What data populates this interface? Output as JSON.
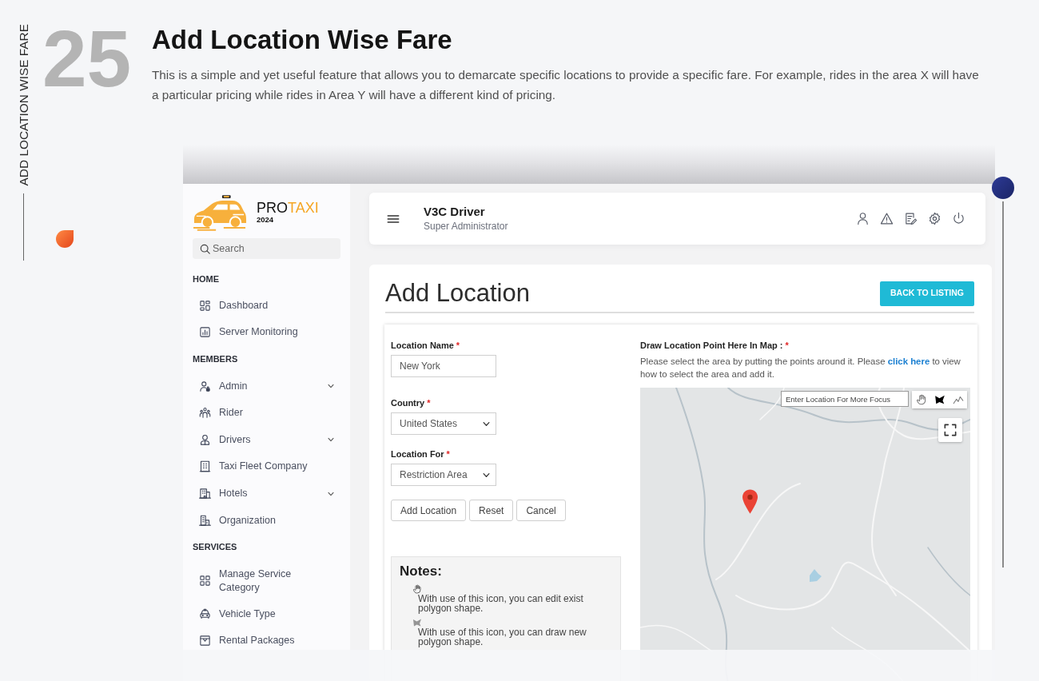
{
  "section": {
    "side_label": "ADD LOCATION WISE FARE",
    "number": "25",
    "title": "Add Location Wise Fare",
    "description": "This is a simple and yet useful feature that allows you to demarcate specific locations to provide a specific fare. For example, rides in the area X will have a particular pricing while rides in Area Y will have a different kind of pricing."
  },
  "app": {
    "brand": {
      "lead": "PRO",
      "accent": "TAXI",
      "year": "2024"
    },
    "sidebar": {
      "search": {
        "placeholder": "Search"
      },
      "groups": [
        {
          "heading": "HOME",
          "items": [
            {
              "label": "Dashboard",
              "has_submenu": false,
              "selected": false
            },
            {
              "label": "Server Monitoring",
              "has_submenu": false,
              "selected": false
            }
          ]
        },
        {
          "heading": "MEMBERS",
          "items": [
            {
              "label": "Admin",
              "has_submenu": true,
              "selected": false
            },
            {
              "label": "Rider",
              "has_submenu": false,
              "selected": false
            },
            {
              "label": "Drivers",
              "has_submenu": true,
              "selected": false
            },
            {
              "label": "Taxi Fleet Company",
              "has_submenu": false,
              "selected": false
            },
            {
              "label": "Hotels",
              "has_submenu": true,
              "selected": false
            },
            {
              "label": "Organization",
              "has_submenu": false,
              "selected": false
            }
          ]
        },
        {
          "heading": "SERVICES",
          "items": [
            {
              "label": "Manage Service Category",
              "has_submenu": false,
              "selected": false
            },
            {
              "label": "Vehicle Type",
              "has_submenu": false,
              "selected": false
            },
            {
              "label": "Rental Packages",
              "has_submenu": false,
              "selected": false
            }
          ]
        }
      ]
    },
    "topbar": {
      "user_name": "V3C Driver",
      "role": "Super Administrator"
    },
    "page": {
      "heading": "Add Location",
      "back_button": "BACK TO LISTING"
    },
    "form": {
      "fields": [
        {
          "kind": "text",
          "label": "Location Name",
          "mark": "*",
          "value": "New York"
        },
        {
          "kind": "select",
          "label": "Country",
          "mark": "*",
          "value": "United States"
        },
        {
          "kind": "select",
          "label": "Location For",
          "mark": "*",
          "value": "Restriction Area"
        }
      ],
      "buttons": [
        "Add Location",
        "Reset",
        "Cancel"
      ]
    },
    "notes": {
      "title": "Notes:",
      "items": [
        "With use of this icon, you can edit exist polygon shape.",
        "With use of this icon, you can draw new polygon shape."
      ]
    },
    "map_panel": {
      "label": "Draw Location Point Here In Map :",
      "mark": "*",
      "help": {
        "before": "Please select the area by putting the points around it. Please ",
        "link": "click here",
        "after": " to view how to select the area and add it."
      },
      "map": {
        "search": {
          "placeholder": "Enter Location For More Focus"
        },
        "tools": [
          {
            "selected": false
          },
          {
            "selected": true
          },
          {
            "selected": false
          }
        ]
      }
    }
  }
}
